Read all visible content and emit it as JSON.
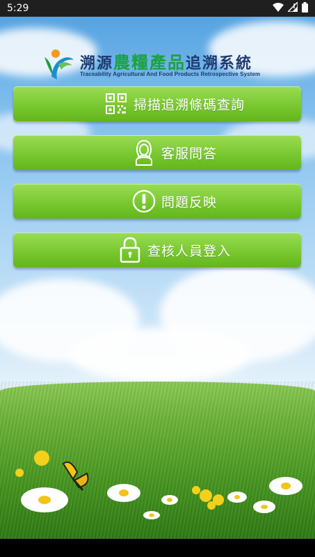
{
  "status_bar": {
    "time": "5:29",
    "icons": [
      "wifi-icon",
      "signal-icon",
      "battery-icon"
    ]
  },
  "header": {
    "title_part1": "溯源",
    "title_part2": "農糧產品",
    "title_part3": "追溯系統",
    "subtitle": "Traceability Agricultural And Food Products Retrospective System"
  },
  "menu": {
    "items": [
      {
        "label": "掃描追溯條碼查詢",
        "icon": "qr-code-icon"
      },
      {
        "label": "客服問答",
        "icon": "customer-service-icon"
      },
      {
        "label": "問題反映",
        "icon": "exclamation-icon"
      },
      {
        "label": "查核人員登入",
        "icon": "lock-icon"
      }
    ]
  },
  "colors": {
    "button_green": "#7fcc36",
    "title_navy": "#1d3a6e",
    "title_green": "#1aa23e"
  }
}
